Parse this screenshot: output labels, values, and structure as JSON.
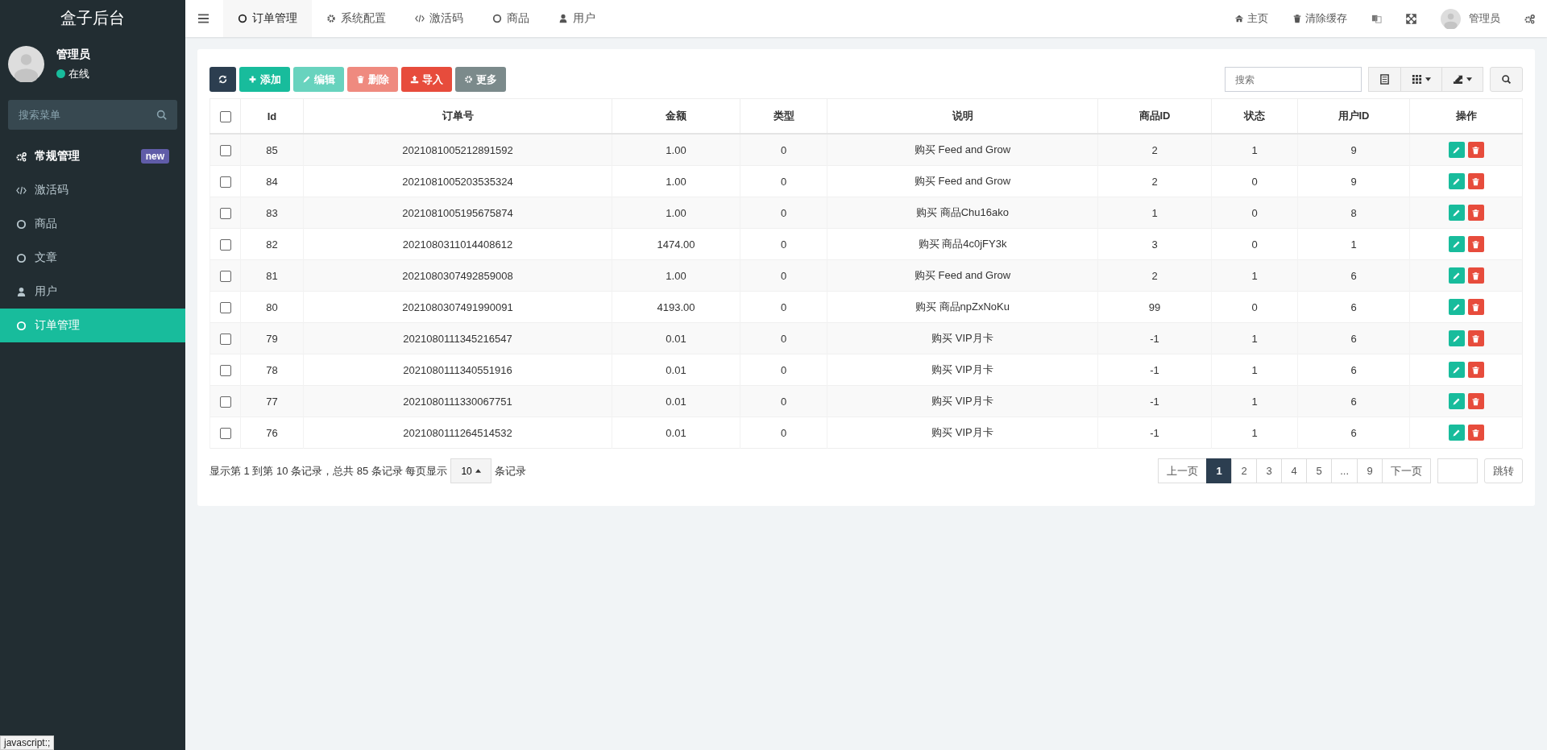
{
  "sidebar": {
    "title": "盒子后台",
    "user": {
      "name": "管理员",
      "status": "在线",
      "online": true
    },
    "search": {
      "placeholder": "搜索菜单"
    },
    "items": [
      {
        "label": "常规管理",
        "kind": "cogs",
        "badge": "new",
        "header": true,
        "selected": false
      },
      {
        "label": "激活码",
        "kind": "code",
        "header": false,
        "selected": false
      },
      {
        "label": "商品",
        "kind": "circle",
        "header": false,
        "selected": false
      },
      {
        "label": "文章",
        "kind": "circle",
        "header": false,
        "selected": false
      },
      {
        "label": "用户",
        "kind": "user",
        "header": false,
        "selected": false
      },
      {
        "label": "订单管理",
        "kind": "circle",
        "header": false,
        "selected": true
      }
    ]
  },
  "tabs": [
    {
      "label": "订单管理",
      "kind": "circle",
      "selected": true
    },
    {
      "label": "系统配置",
      "kind": "gear",
      "selected": false
    },
    {
      "label": "激活码",
      "kind": "code",
      "selected": false
    },
    {
      "label": "商品",
      "kind": "circle",
      "selected": false
    },
    {
      "label": "用户",
      "kind": "user",
      "selected": false
    }
  ],
  "topnav": {
    "home": "主页",
    "clear_cache": "清除缓存",
    "user": "管理员"
  },
  "toolbar": {
    "buttons": [
      {
        "kind": "refresh",
        "disabled": false
      },
      {
        "kind": "add",
        "label": "添加",
        "disabled": false
      },
      {
        "kind": "edit",
        "label": "编辑",
        "disabled": true
      },
      {
        "kind": "delete",
        "label": "删除",
        "disabled": true
      },
      {
        "kind": "import",
        "label": "导入",
        "disabled": false
      },
      {
        "kind": "more",
        "label": "更多",
        "disabled": false
      }
    ],
    "search": {
      "placeholder": "搜索"
    }
  },
  "table": {
    "select_all_checked": false,
    "columns": [
      "Id",
      "订单号",
      "金额",
      "类型",
      "说明",
      "商品ID",
      "状态",
      "用户ID",
      "操作"
    ],
    "rows": [
      {
        "checked": false,
        "cells": [
          "85",
          "2021081005212891592",
          "1.00",
          "0",
          "购买 Feed and Grow",
          "2",
          "1",
          "9"
        ]
      },
      {
        "checked": false,
        "cells": [
          "84",
          "2021081005203535324",
          "1.00",
          "0",
          "购买 Feed and Grow",
          "2",
          "0",
          "9"
        ]
      },
      {
        "checked": false,
        "cells": [
          "83",
          "2021081005195675874",
          "1.00",
          "0",
          "购买 商品Chu16ako",
          "1",
          "0",
          "8"
        ]
      },
      {
        "checked": false,
        "cells": [
          "82",
          "2021080311014408612",
          "1474.00",
          "0",
          "购买 商品4c0jFY3k",
          "3",
          "0",
          "1"
        ]
      },
      {
        "checked": false,
        "cells": [
          "81",
          "2021080307492859008",
          "1.00",
          "0",
          "购买 Feed and Grow",
          "2",
          "1",
          "6"
        ]
      },
      {
        "checked": false,
        "cells": [
          "80",
          "2021080307491990091",
          "4193.00",
          "0",
          "购买 商品npZxNoKu",
          "99",
          "0",
          "6"
        ]
      },
      {
        "checked": false,
        "cells": [
          "79",
          "2021080111345216547",
          "0.01",
          "0",
          "购买 VIP月卡",
          "-1",
          "1",
          "6"
        ]
      },
      {
        "checked": false,
        "cells": [
          "78",
          "2021080111340551916",
          "0.01",
          "0",
          "购买 VIP月卡",
          "-1",
          "1",
          "6"
        ]
      },
      {
        "checked": false,
        "cells": [
          "77",
          "2021080111330067751",
          "0.01",
          "0",
          "购买 VIP月卡",
          "-1",
          "1",
          "6"
        ]
      },
      {
        "checked": false,
        "cells": [
          "76",
          "2021080111264514532",
          "0.01",
          "0",
          "购买 VIP月卡",
          "-1",
          "1",
          "6"
        ]
      }
    ]
  },
  "pagination": {
    "summary": "显示第 1 到第 10 条记录，总共 85 条记录 每页显示",
    "page_size": "10",
    "suffix": "条记录",
    "prev": "上一页",
    "next": "下一页",
    "pages": [
      {
        "label": "1",
        "selected": true
      },
      {
        "label": "2",
        "selected": false
      },
      {
        "label": "3",
        "selected": false
      },
      {
        "label": "4",
        "selected": false
      },
      {
        "label": "5",
        "selected": false
      },
      {
        "label": "...",
        "selected": false
      },
      {
        "label": "9",
        "selected": false
      }
    ],
    "jump": "跳转"
  },
  "browser_status": "javascript:;"
}
